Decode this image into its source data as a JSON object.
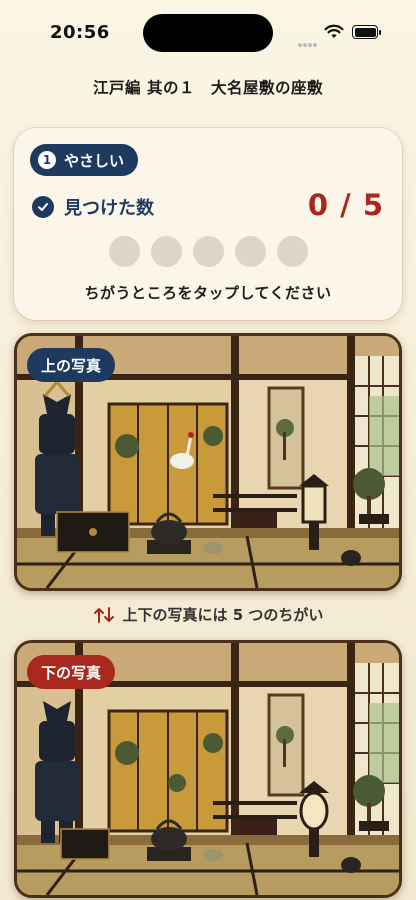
{
  "status_bar": {
    "time": "20:56"
  },
  "header": {
    "title": "江戸編 其の１　大名屋敷の座敷"
  },
  "card": {
    "difficulty_number": "1",
    "difficulty_label": "やさしい",
    "found_label": "見つけた数",
    "score": "0 / 5",
    "found_count": 0,
    "total_differences": 5,
    "hint": "ちがうところをタップしてください"
  },
  "photos": {
    "top_label": "上の写真",
    "bottom_label": "下の写真",
    "note": "上下の写真には 5 つのちがい"
  },
  "colors": {
    "navy": "#1f3a5f",
    "red": "#a8281e",
    "dot": "#ddd6c6"
  }
}
